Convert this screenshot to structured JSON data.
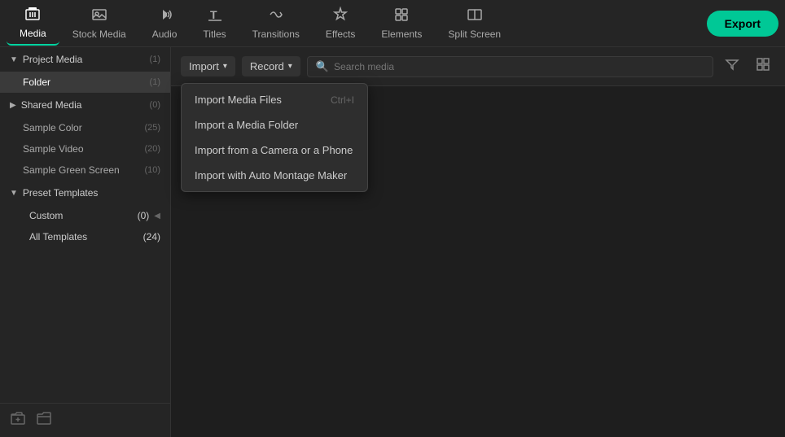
{
  "nav": {
    "items": [
      {
        "id": "media",
        "label": "Media",
        "icon": "🎞",
        "active": true
      },
      {
        "id": "stock-media",
        "label": "Stock Media",
        "icon": "🖼"
      },
      {
        "id": "audio",
        "label": "Audio",
        "icon": "🎵"
      },
      {
        "id": "titles",
        "label": "Titles",
        "icon": "T"
      },
      {
        "id": "transitions",
        "label": "Transitions",
        "icon": "↔"
      },
      {
        "id": "effects",
        "label": "Effects",
        "icon": "✦"
      },
      {
        "id": "elements",
        "label": "Elements",
        "icon": "◈"
      },
      {
        "id": "split-screen",
        "label": "Split Screen",
        "icon": "⊟"
      }
    ],
    "export_label": "Export"
  },
  "toolbar": {
    "import_label": "Import",
    "record_label": "Record",
    "search_placeholder": "Search media",
    "chevron": "▾"
  },
  "dropdown": {
    "items": [
      {
        "id": "import-files",
        "label": "Import Media Files",
        "shortcut": "Ctrl+I"
      },
      {
        "id": "import-folder",
        "label": "Import a Media Folder",
        "shortcut": ""
      },
      {
        "id": "import-camera",
        "label": "Import from a Camera or a Phone",
        "shortcut": ""
      },
      {
        "id": "import-montage",
        "label": "Import with Auto Montage Maker",
        "shortcut": ""
      }
    ]
  },
  "sidebar": {
    "sections": [
      {
        "id": "project-media",
        "label": "Project Media",
        "count": "(1)",
        "expanded": true,
        "items": [
          {
            "id": "folder",
            "label": "Folder",
            "count": "(1)",
            "active": true
          }
        ]
      },
      {
        "id": "shared-media",
        "label": "Shared Media",
        "count": "(0)",
        "expanded": false,
        "items": []
      }
    ],
    "standalone_items": [
      {
        "id": "sample-color",
        "label": "Sample Color",
        "count": "(25)"
      },
      {
        "id": "sample-video",
        "label": "Sample Video",
        "count": "(20)"
      },
      {
        "id": "sample-green-screen",
        "label": "Sample Green Screen",
        "count": "(10)"
      }
    ],
    "preset_section": {
      "label": "Preset Templates",
      "expanded": true,
      "sub_items": [
        {
          "id": "custom",
          "label": "Custom",
          "count": "(0)",
          "arrow": "◀"
        },
        {
          "id": "all-templates",
          "label": "All Templates",
          "count": "(24)"
        }
      ]
    },
    "footer_buttons": [
      {
        "id": "add-folder",
        "icon": "📁+",
        "unicode": "🗀"
      },
      {
        "id": "new-folder",
        "icon": "📂",
        "unicode": "🗁"
      }
    ]
  }
}
